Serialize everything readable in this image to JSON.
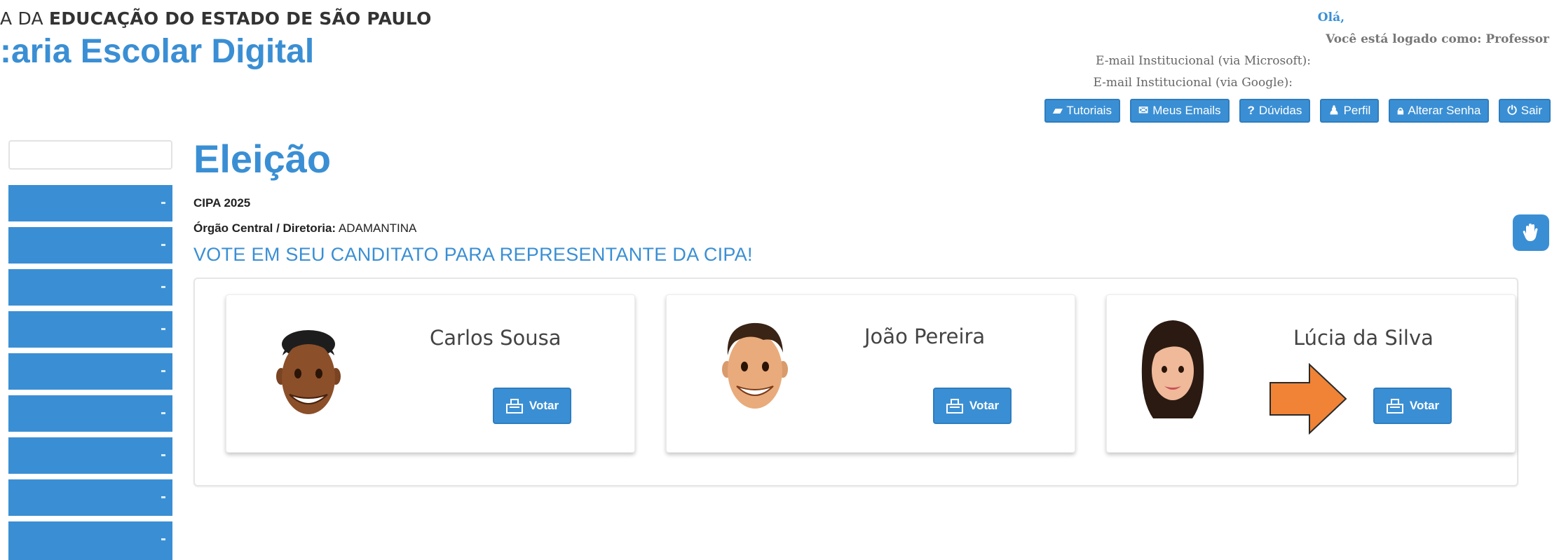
{
  "header": {
    "gov_prefix": "A DA ",
    "gov_bold": "EDUCAÇÃO DO ESTADO DE SÃO PAULO",
    "brand": ":aria Escolar Digital"
  },
  "user": {
    "hello": "Olá,",
    "logged_as": "Você está logado como: Professor",
    "email_microsoft": "E-mail Institucional (via Microsoft):",
    "email_google": "E-mail Institucional (via Google):"
  },
  "top_buttons": [
    {
      "icon": "book-icon",
      "glyph": "▰",
      "label": "Tutoriais"
    },
    {
      "icon": "envelope-icon",
      "glyph": "✉",
      "label": "Meus Emails"
    },
    {
      "icon": "question-icon",
      "glyph": "?",
      "label": "Dúvidas"
    },
    {
      "icon": "user-icon",
      "glyph": "♟",
      "label": "Perfil"
    },
    {
      "icon": "lock-icon",
      "glyph": "🔒︎",
      "label": "Alterar Senha"
    },
    {
      "icon": "power-icon",
      "glyph": "⏻",
      "label": "Sair"
    }
  ],
  "page": {
    "title": "Eleição",
    "election": "CIPA 2025",
    "org_label": "Órgão Central / Diretoria:",
    "org_value": " ADAMANTINA",
    "instruction": "VOTE EM SEU CANDITATO PARA REPRESENTANTE DA CIPA!"
  },
  "candidates": [
    {
      "name": "Carlos Sousa",
      "vote_label": "Votar"
    },
    {
      "name": "João Pereira",
      "vote_label": "Votar"
    },
    {
      "name": "Lúcia da Silva",
      "vote_label": "Votar"
    }
  ],
  "colors": {
    "accent": "#3a8fd4",
    "arrow": "#f08336"
  },
  "icons": {
    "fab": "accessibility-hand-icon",
    "vote": "ballot-box-icon"
  }
}
